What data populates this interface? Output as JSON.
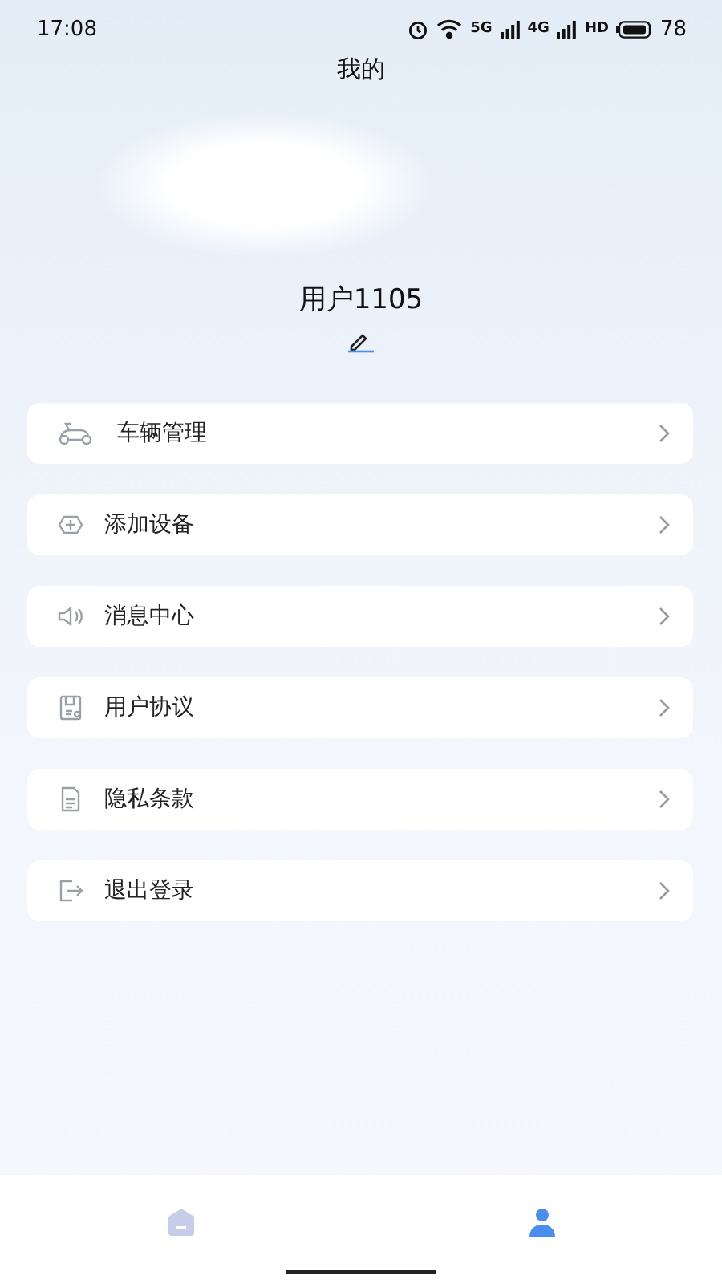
{
  "status_bar": {
    "time": "17:08",
    "network_1": "5G",
    "network_2": "4G",
    "hd": "HD",
    "battery": "78"
  },
  "title": "我的",
  "user": {
    "name": "用户1105"
  },
  "menu": [
    {
      "kind": "vehicle",
      "label": "车辆管理"
    },
    {
      "kind": "add",
      "label": "添加设备"
    },
    {
      "kind": "message",
      "label": "消息中心"
    },
    {
      "kind": "agreement",
      "label": "用户协议"
    },
    {
      "kind": "privacy",
      "label": "隐私条款"
    },
    {
      "kind": "logout",
      "label": "退出登录"
    }
  ],
  "tab_bar": [
    {
      "kind": "home",
      "selected": false
    },
    {
      "kind": "profile",
      "selected": true
    }
  ]
}
